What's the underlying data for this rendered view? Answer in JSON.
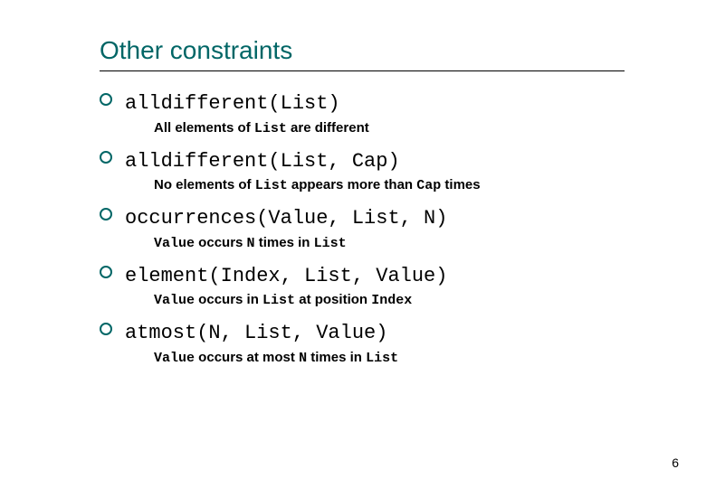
{
  "slide": {
    "title": "Other constraints",
    "page_number": "6",
    "items": [
      {
        "code": "alldifferent(List)",
        "desc_parts": [
          "All elements of ",
          "List",
          " are different"
        ]
      },
      {
        "code": "alldifferent(List, Cap)",
        "desc_parts": [
          "No elements of ",
          "List",
          " appears more than ",
          "Cap",
          " times"
        ]
      },
      {
        "code": "occurrences(Value, List, N)",
        "desc_parts": [
          "Value",
          " occurs ",
          "N",
          " times in ",
          "List"
        ]
      },
      {
        "code": "element(Index, List, Value)",
        "desc_parts": [
          "Value",
          " occurs in ",
          "List",
          " at position ",
          "Index"
        ]
      },
      {
        "code": "atmost(N, List, Value)",
        "desc_parts": [
          "Value",
          " occurs at most ",
          "N",
          " times in ",
          "List"
        ]
      }
    ]
  }
}
